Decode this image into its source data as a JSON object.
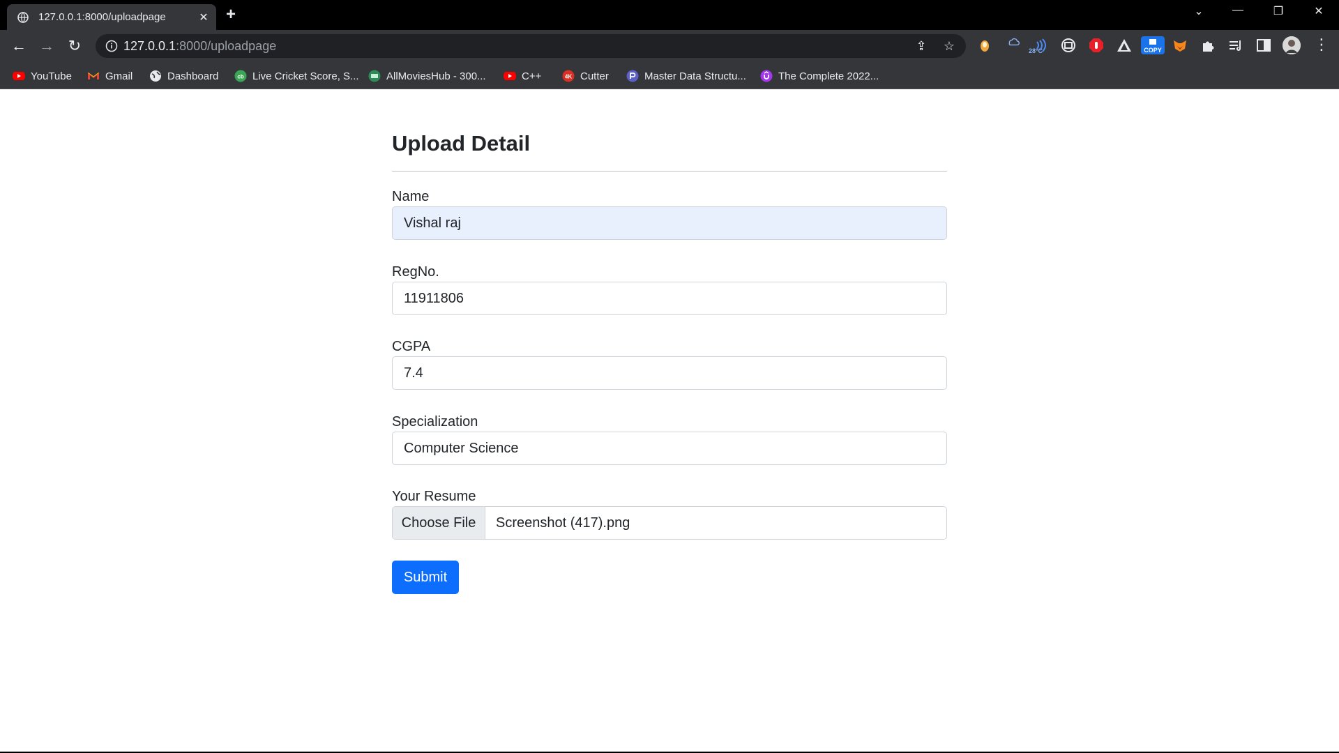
{
  "browser": {
    "tab": {
      "title": "127.0.0.1:8000/uploadpage"
    },
    "address": {
      "host": "127.0.0.1",
      "path": ":8000/uploadpage"
    },
    "weather_badge": "28°C",
    "copy_badge": "COPY",
    "bookmarks": [
      {
        "label": "YouTube",
        "icon": "youtube-icon",
        "color": "#ff0000"
      },
      {
        "label": "Gmail",
        "icon": "gmail-icon",
        "color": "#ea4335"
      },
      {
        "label": "Dashboard",
        "icon": "globe-icon",
        "color": "#e8eaed"
      },
      {
        "label": "Live Cricket Score, S...",
        "icon": "cricbuzz-icon",
        "color": "#3aa655"
      },
      {
        "label": "AllMoviesHub - 300...",
        "icon": "allmovieshub-icon",
        "color": "#2e8b57"
      },
      {
        "label": "C++",
        "icon": "youtube-icon",
        "color": "#ff0000"
      },
      {
        "label": "Cutter",
        "icon": "4k-icon",
        "color": "#d93025"
      },
      {
        "label": "Master Data Structu...",
        "icon": "course-icon",
        "color": "#5b5fc7"
      },
      {
        "label": "The Complete 2022...",
        "icon": "udemy-icon",
        "color": "#a435f0"
      }
    ]
  },
  "form": {
    "title": "Upload Detail",
    "fields": {
      "name": {
        "label": "Name",
        "value": "Vishal raj"
      },
      "regno": {
        "label": "RegNo.",
        "value": "11911806"
      },
      "cgpa": {
        "label": "CGPA",
        "value": "7.4"
      },
      "specialization": {
        "label": "Specialization",
        "value": "Computer Science"
      },
      "resume": {
        "label": "Your Resume",
        "button": "Choose File",
        "filename": "Screenshot (417).png"
      }
    },
    "submit": "Submit",
    "colors": {
      "primary": "#0d6efd",
      "autofill": "#e8f0fe"
    }
  }
}
